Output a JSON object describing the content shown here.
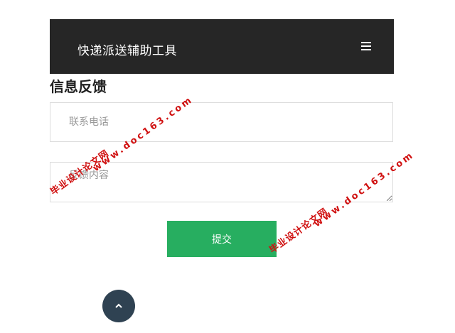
{
  "header": {
    "brand": "快递派送辅助工具",
    "menu_icon": "hamburger-menu-icon"
  },
  "page": {
    "title": "信息反馈"
  },
  "form": {
    "phone_placeholder": "联系电话",
    "feedback_placeholder": "反馈内容",
    "submit_label": "提交"
  },
  "back_to_top": {
    "icon": "chevron-up-icon"
  },
  "watermark": {
    "text": "毕业设计论文网",
    "url": "www.doc163.com"
  },
  "colors": {
    "navbar_bg": "#262626",
    "submit_bg": "#27ae60",
    "back_top_bg": "#2f4252",
    "watermark": "#d01010"
  }
}
